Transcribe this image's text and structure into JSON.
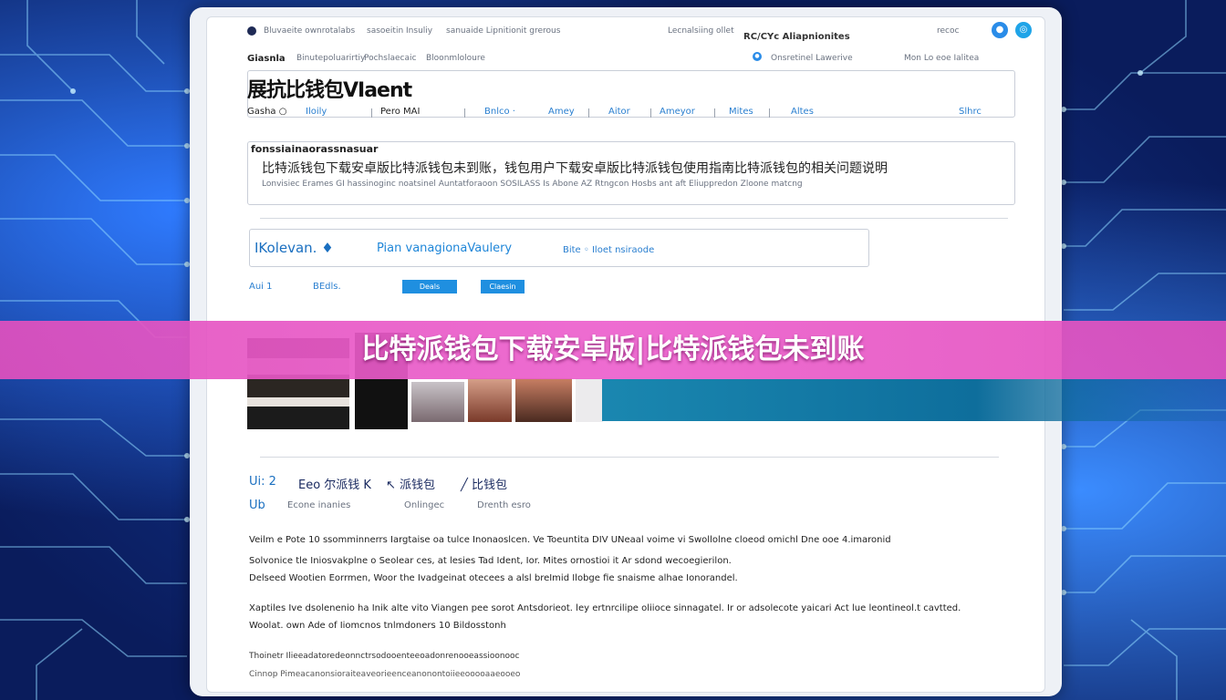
{
  "banner": {
    "title": "比特派钱包下载安卓版|比特派钱包未到账"
  },
  "topbar": {
    "left_text": "Bluvaeite ownrotalabs",
    "mid_text_1": "sasoeitin Insuliy",
    "mid_text_2": "sanuaide Lipnitionit grerous",
    "mid_text_3": "Lecnalsiing ollet",
    "brand": "RC/CYc Aliapnionites",
    "right_text": "recoc"
  },
  "subbar": {
    "left_1": "Giasnla",
    "left_2": "Binutepoluarirtiy",
    "left_3": "Pochslaecaic",
    "left_4": "Bloonmloloure",
    "mid": "Onsretinel Lawerive",
    "right": "Mon Lo eoe Ialitea"
  },
  "nav": {
    "logo_text": "展抗比钱包VIaent",
    "items": [
      "Gasha ○",
      "Iloily",
      "Pero MAI",
      "Bnlco ·",
      "Amey",
      "Aitor",
      "Ameyor",
      "Mites",
      "Altes",
      "Slhrc"
    ]
  },
  "article_box": {
    "line1": "fonssiainaorassnasuar",
    "line2": "比特派钱包下载安卓版比特派钱包未到账，钱包用户下载安卓版比特派钱包使用指南比特派钱包的相关问题说明",
    "line3": "Lonvisiec Erames GI hassinoginc noatsinel Auntatforaoon SOSILASS Is Abone AZ Rtngcon Hosbs ant aft Eliuppredon Zloone matcng"
  },
  "feature": {
    "title": "IKolevan. ♦",
    "tagline": "Pian vanagionaVaulery",
    "badge": "Bite ◦ Iloet nsiraode",
    "stat1": "Aui 1",
    "stat2": "BEdls.",
    "btn1": "Deals",
    "btn2": "Claesin"
  },
  "section2": {
    "h1": "Ui: 2",
    "h2": "Eeo 尔派钱 K",
    "h3": "↖ 派钱包",
    "h4": "╱ 比钱包",
    "r1": "Ub",
    "r2": "Econe inanies",
    "r3": "Onlingec",
    "r4": "Drenth esro"
  },
  "body_text": {
    "p1": "Veilm e Pote 10 ssomminnerrs Iargtaise oa tulce Inonaoslcen. Ve Toeuntita DIV UNeaal voime vi Swollolne cloeod omichl Dne ooe 4.imaronid",
    "p2": "Solvonice tle Iniosvakplne o Seolear ces, at lesies Tad Ident, Ior. Mites ornostioi it Ar sdond wecoegierilon.",
    "p3": "Delseed Wootien Eorrmen, Woor the Ivadgeinat otecees a alsl breImid Ilobge fie snaisme alhae Ionorandel.",
    "p4": "Xaptiles Ive dsolenenio ha Inik alte vito Viangen pee sorot Antsdorieot. ley ertnrcilipe oliioce sinnagatel. Ir or adsolecote yaicari Act lue leontineol.t cavtted.",
    "p5": "Woolat. own Ade of Iiomcnos tnlmdoners 10 Bildosstonh",
    "p6": "Thoinetr Ilieeadatoredeonnctrsodooenteeoadonrenooeassioonooc",
    "p7": "Cinnop Pimeacanonsioraiteaveorieenceanonontoiieeooooaaeooeo"
  }
}
